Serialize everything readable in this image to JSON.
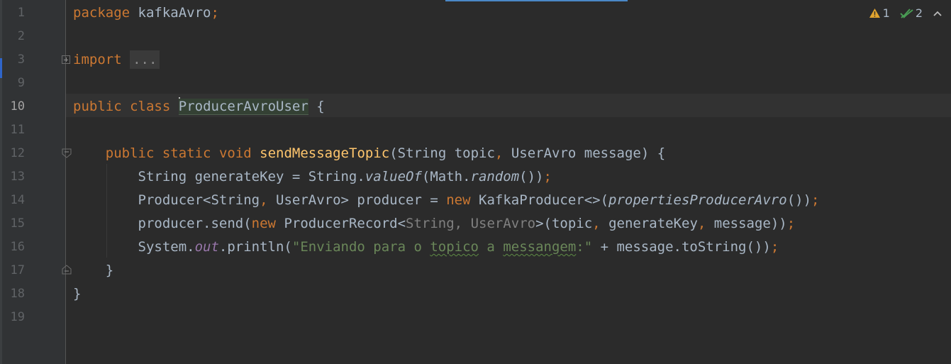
{
  "colors": {
    "background": "#2b2b2b",
    "gutter": "#313335",
    "keyword": "#cc7832",
    "function": "#ffc66d",
    "string": "#6a8759",
    "field": "#9876aa",
    "default_text": "#a9b7c6",
    "warning": "#e0a32e",
    "ok": "#499c54"
  },
  "inspection": {
    "warning_count": "1",
    "weak_warning_count": "2",
    "warning_icon": "warning-triangle-icon",
    "weak_warning_icon": "double-check-icon",
    "collapse_icon": "chevron-up-icon"
  },
  "code": {
    "lines": [
      {
        "number": "1",
        "tokens": [
          {
            "t": "package",
            "c": "kw"
          },
          {
            "t": " kafkaAvro"
          },
          {
            "t": ";",
            "c": "kw"
          }
        ]
      },
      {
        "number": "2",
        "tokens": []
      },
      {
        "number": "3",
        "tokens": [
          {
            "t": "import",
            "c": "kw"
          },
          {
            "t": " "
          },
          {
            "t": "...",
            "c": "folded"
          }
        ]
      },
      {
        "number": "9",
        "tokens": []
      },
      {
        "number": "10",
        "tokens": [
          {
            "t": "public",
            "c": "kw"
          },
          {
            "t": " "
          },
          {
            "t": "class",
            "c": "kw"
          },
          {
            "t": " "
          },
          {
            "t": "",
            "c": "caret"
          },
          {
            "t": "ProducerAvroUser",
            "c": "class-name-hl"
          },
          {
            "t": " {"
          }
        ]
      },
      {
        "number": "11",
        "tokens": []
      },
      {
        "number": "12",
        "tokens": [
          {
            "t": "    "
          },
          {
            "t": "public",
            "c": "kw"
          },
          {
            "t": " "
          },
          {
            "t": "static",
            "c": "kw"
          },
          {
            "t": " "
          },
          {
            "t": "void",
            "c": "kw"
          },
          {
            "t": " "
          },
          {
            "t": "sendMessageTopic",
            "c": "fn"
          },
          {
            "t": "(String topic"
          },
          {
            "t": ",",
            "c": "kw"
          },
          {
            "t": " UserAvro message) {"
          }
        ]
      },
      {
        "number": "13",
        "tokens": [
          {
            "t": "        String generateKey = String."
          },
          {
            "t": "valueOf",
            "c": "it"
          },
          {
            "t": "(Math."
          },
          {
            "t": "random",
            "c": "it"
          },
          {
            "t": "())"
          },
          {
            "t": ";",
            "c": "kw"
          }
        ]
      },
      {
        "number": "14",
        "tokens": [
          {
            "t": "        Producer<String"
          },
          {
            "t": ",",
            "c": "kw"
          },
          {
            "t": " UserAvro> producer = "
          },
          {
            "t": "new",
            "c": "kw"
          },
          {
            "t": " KafkaProducer<>("
          },
          {
            "t": "propertiesProducerAvro",
            "c": "it"
          },
          {
            "t": "())"
          },
          {
            "t": ";",
            "c": "kw"
          }
        ]
      },
      {
        "number": "15",
        "tokens": [
          {
            "t": "        producer.send("
          },
          {
            "t": "new",
            "c": "kw"
          },
          {
            "t": " ProducerRecord<"
          },
          {
            "t": "String",
            "c": "gen"
          },
          {
            "t": ",",
            "c": "gen"
          },
          {
            "t": " "
          },
          {
            "t": "UserAvro",
            "c": "gen"
          },
          {
            "t": ">(topic"
          },
          {
            "t": ",",
            "c": "kw"
          },
          {
            "t": " generateKey"
          },
          {
            "t": ",",
            "c": "kw"
          },
          {
            "t": " message))"
          },
          {
            "t": ";",
            "c": "kw"
          }
        ]
      },
      {
        "number": "16",
        "tokens": [
          {
            "t": "        System."
          },
          {
            "t": "out",
            "c": "field"
          },
          {
            "t": ".println("
          },
          {
            "t": "\"Enviando para o ",
            "c": "str"
          },
          {
            "t": "topico",
            "c": "str typo"
          },
          {
            "t": " a ",
            "c": "str"
          },
          {
            "t": "messangem",
            "c": "str typo"
          },
          {
            "t": ":\"",
            "c": "str"
          },
          {
            "t": " + message.toString())"
          },
          {
            "t": ";",
            "c": "kw"
          }
        ]
      },
      {
        "number": "17",
        "tokens": [
          {
            "t": "    }"
          }
        ]
      },
      {
        "number": "18",
        "tokens": [
          {
            "t": "}"
          }
        ]
      },
      {
        "number": "19",
        "tokens": []
      }
    ]
  }
}
